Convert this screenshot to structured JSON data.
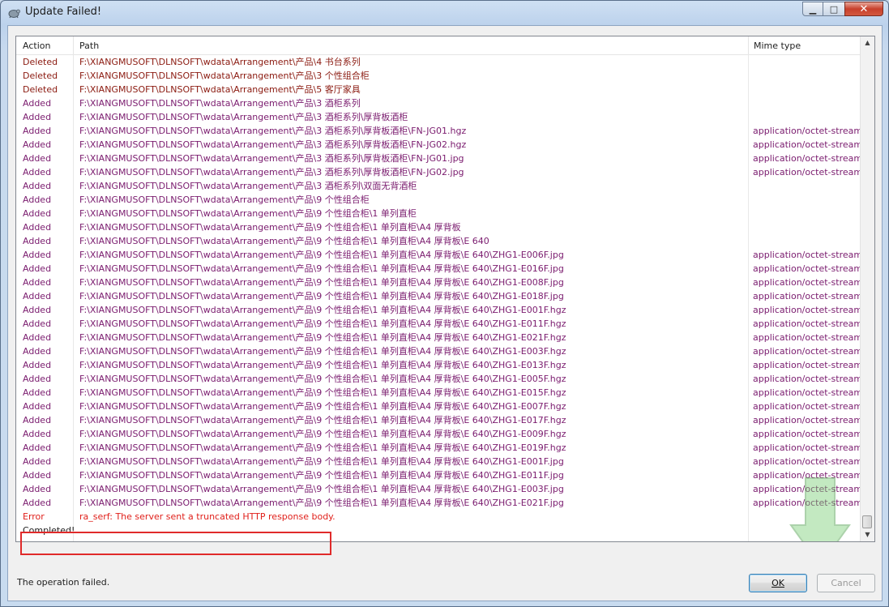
{
  "window": {
    "title": "Update Failed!",
    "icon": "tortoise-icon"
  },
  "controls": {
    "minimize": "▁",
    "maximize": "□",
    "close": "✕"
  },
  "table": {
    "columns": {
      "action": "Action",
      "path": "Path",
      "mime": "Mime type"
    },
    "rows": [
      {
        "action": "Deleted",
        "path": "F:\\XIANGMUSOFT\\DLNSOFT\\wdata\\Arrangement\\产品\\4 书台系列",
        "mime": "",
        "type": "deleted"
      },
      {
        "action": "Deleted",
        "path": "F:\\XIANGMUSOFT\\DLNSOFT\\wdata\\Arrangement\\产品\\3 个性组合柜",
        "mime": "",
        "type": "deleted"
      },
      {
        "action": "Deleted",
        "path": "F:\\XIANGMUSOFT\\DLNSOFT\\wdata\\Arrangement\\产品\\5 客厅家具",
        "mime": "",
        "type": "deleted"
      },
      {
        "action": "Added",
        "path": "F:\\XIANGMUSOFT\\DLNSOFT\\wdata\\Arrangement\\产品\\3 酒柜系列",
        "mime": "",
        "type": "added"
      },
      {
        "action": "Added",
        "path": "F:\\XIANGMUSOFT\\DLNSOFT\\wdata\\Arrangement\\产品\\3 酒柜系列\\厚背板酒柜",
        "mime": "",
        "type": "added"
      },
      {
        "action": "Added",
        "path": "F:\\XIANGMUSOFT\\DLNSOFT\\wdata\\Arrangement\\产品\\3 酒柜系列\\厚背板酒柜\\FN-JG01.hgz",
        "mime": "application/octet-stream",
        "type": "added"
      },
      {
        "action": "Added",
        "path": "F:\\XIANGMUSOFT\\DLNSOFT\\wdata\\Arrangement\\产品\\3 酒柜系列\\厚背板酒柜\\FN-JG02.hgz",
        "mime": "application/octet-stream",
        "type": "added"
      },
      {
        "action": "Added",
        "path": "F:\\XIANGMUSOFT\\DLNSOFT\\wdata\\Arrangement\\产品\\3 酒柜系列\\厚背板酒柜\\FN-JG01.jpg",
        "mime": "application/octet-stream",
        "type": "added"
      },
      {
        "action": "Added",
        "path": "F:\\XIANGMUSOFT\\DLNSOFT\\wdata\\Arrangement\\产品\\3 酒柜系列\\厚背板酒柜\\FN-JG02.jpg",
        "mime": "application/octet-stream",
        "type": "added"
      },
      {
        "action": "Added",
        "path": "F:\\XIANGMUSOFT\\DLNSOFT\\wdata\\Arrangement\\产品\\3 酒柜系列\\双面无背酒柜",
        "mime": "",
        "type": "added"
      },
      {
        "action": "Added",
        "path": "F:\\XIANGMUSOFT\\DLNSOFT\\wdata\\Arrangement\\产品\\9 个性组合柜",
        "mime": "",
        "type": "added"
      },
      {
        "action": "Added",
        "path": "F:\\XIANGMUSOFT\\DLNSOFT\\wdata\\Arrangement\\产品\\9 个性组合柜\\1 单列直柜",
        "mime": "",
        "type": "added"
      },
      {
        "action": "Added",
        "path": "F:\\XIANGMUSOFT\\DLNSOFT\\wdata\\Arrangement\\产品\\9 个性组合柜\\1 单列直柜\\A4 厚背板",
        "mime": "",
        "type": "added"
      },
      {
        "action": "Added",
        "path": "F:\\XIANGMUSOFT\\DLNSOFT\\wdata\\Arrangement\\产品\\9 个性组合柜\\1 单列直柜\\A4 厚背板\\E 640",
        "mime": "",
        "type": "added"
      },
      {
        "action": "Added",
        "path": "F:\\XIANGMUSOFT\\DLNSOFT\\wdata\\Arrangement\\产品\\9 个性组合柜\\1 单列直柜\\A4 厚背板\\E 640\\ZHG1-E006F.jpg",
        "mime": "application/octet-stream",
        "type": "added"
      },
      {
        "action": "Added",
        "path": "F:\\XIANGMUSOFT\\DLNSOFT\\wdata\\Arrangement\\产品\\9 个性组合柜\\1 单列直柜\\A4 厚背板\\E 640\\ZHG1-E016F.jpg",
        "mime": "application/octet-stream",
        "type": "added"
      },
      {
        "action": "Added",
        "path": "F:\\XIANGMUSOFT\\DLNSOFT\\wdata\\Arrangement\\产品\\9 个性组合柜\\1 单列直柜\\A4 厚背板\\E 640\\ZHG1-E008F.jpg",
        "mime": "application/octet-stream",
        "type": "added"
      },
      {
        "action": "Added",
        "path": "F:\\XIANGMUSOFT\\DLNSOFT\\wdata\\Arrangement\\产品\\9 个性组合柜\\1 单列直柜\\A4 厚背板\\E 640\\ZHG1-E018F.jpg",
        "mime": "application/octet-stream",
        "type": "added"
      },
      {
        "action": "Added",
        "path": "F:\\XIANGMUSOFT\\DLNSOFT\\wdata\\Arrangement\\产品\\9 个性组合柜\\1 单列直柜\\A4 厚背板\\E 640\\ZHG1-E001F.hgz",
        "mime": "application/octet-stream",
        "type": "added"
      },
      {
        "action": "Added",
        "path": "F:\\XIANGMUSOFT\\DLNSOFT\\wdata\\Arrangement\\产品\\9 个性组合柜\\1 单列直柜\\A4 厚背板\\E 640\\ZHG1-E011F.hgz",
        "mime": "application/octet-stream",
        "type": "added"
      },
      {
        "action": "Added",
        "path": "F:\\XIANGMUSOFT\\DLNSOFT\\wdata\\Arrangement\\产品\\9 个性组合柜\\1 单列直柜\\A4 厚背板\\E 640\\ZHG1-E021F.hgz",
        "mime": "application/octet-stream",
        "type": "added"
      },
      {
        "action": "Added",
        "path": "F:\\XIANGMUSOFT\\DLNSOFT\\wdata\\Arrangement\\产品\\9 个性组合柜\\1 单列直柜\\A4 厚背板\\E 640\\ZHG1-E003F.hgz",
        "mime": "application/octet-stream",
        "type": "added"
      },
      {
        "action": "Added",
        "path": "F:\\XIANGMUSOFT\\DLNSOFT\\wdata\\Arrangement\\产品\\9 个性组合柜\\1 单列直柜\\A4 厚背板\\E 640\\ZHG1-E013F.hgz",
        "mime": "application/octet-stream",
        "type": "added"
      },
      {
        "action": "Added",
        "path": "F:\\XIANGMUSOFT\\DLNSOFT\\wdata\\Arrangement\\产品\\9 个性组合柜\\1 单列直柜\\A4 厚背板\\E 640\\ZHG1-E005F.hgz",
        "mime": "application/octet-stream",
        "type": "added"
      },
      {
        "action": "Added",
        "path": "F:\\XIANGMUSOFT\\DLNSOFT\\wdata\\Arrangement\\产品\\9 个性组合柜\\1 单列直柜\\A4 厚背板\\E 640\\ZHG1-E015F.hgz",
        "mime": "application/octet-stream",
        "type": "added"
      },
      {
        "action": "Added",
        "path": "F:\\XIANGMUSOFT\\DLNSOFT\\wdata\\Arrangement\\产品\\9 个性组合柜\\1 单列直柜\\A4 厚背板\\E 640\\ZHG1-E007F.hgz",
        "mime": "application/octet-stream",
        "type": "added"
      },
      {
        "action": "Added",
        "path": "F:\\XIANGMUSOFT\\DLNSOFT\\wdata\\Arrangement\\产品\\9 个性组合柜\\1 单列直柜\\A4 厚背板\\E 640\\ZHG1-E017F.hgz",
        "mime": "application/octet-stream",
        "type": "added"
      },
      {
        "action": "Added",
        "path": "F:\\XIANGMUSOFT\\DLNSOFT\\wdata\\Arrangement\\产品\\9 个性组合柜\\1 单列直柜\\A4 厚背板\\E 640\\ZHG1-E009F.hgz",
        "mime": "application/octet-stream",
        "type": "added"
      },
      {
        "action": "Added",
        "path": "F:\\XIANGMUSOFT\\DLNSOFT\\wdata\\Arrangement\\产品\\9 个性组合柜\\1 单列直柜\\A4 厚背板\\E 640\\ZHG1-E019F.hgz",
        "mime": "application/octet-stream",
        "type": "added"
      },
      {
        "action": "Added",
        "path": "F:\\XIANGMUSOFT\\DLNSOFT\\wdata\\Arrangement\\产品\\9 个性组合柜\\1 单列直柜\\A4 厚背板\\E 640\\ZHG1-E001F.jpg",
        "mime": "application/octet-stream",
        "type": "added"
      },
      {
        "action": "Added",
        "path": "F:\\XIANGMUSOFT\\DLNSOFT\\wdata\\Arrangement\\产品\\9 个性组合柜\\1 单列直柜\\A4 厚背板\\E 640\\ZHG1-E011F.jpg",
        "mime": "application/octet-stream",
        "type": "added"
      },
      {
        "action": "Added",
        "path": "F:\\XIANGMUSOFT\\DLNSOFT\\wdata\\Arrangement\\产品\\9 个性组合柜\\1 单列直柜\\A4 厚背板\\E 640\\ZHG1-E003F.jpg",
        "mime": "application/octet-stream",
        "type": "added"
      },
      {
        "action": "Added",
        "path": "F:\\XIANGMUSOFT\\DLNSOFT\\wdata\\Arrangement\\产品\\9 个性组合柜\\1 单列直柜\\A4 厚背板\\E 640\\ZHG1-E021F.jpg",
        "mime": "application/octet-stream",
        "type": "added"
      },
      {
        "action": "Error",
        "path": "ra_serf: The server sent a truncated HTTP response body.",
        "mime": "",
        "type": "error"
      },
      {
        "action": "Completed!",
        "path": "",
        "mime": "",
        "type": "completed"
      }
    ]
  },
  "status_text": "The operation failed.",
  "buttons": {
    "ok": "OK",
    "cancel": "Cancel"
  },
  "colors": {
    "deleted": "#8b1a10",
    "added": "#7a1b6e",
    "error": "#e0201b",
    "highlight": "#e02a2a"
  }
}
